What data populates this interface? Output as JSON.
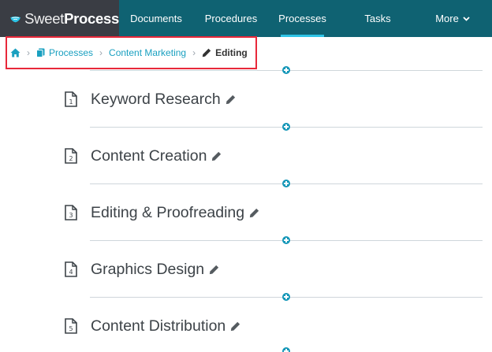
{
  "brand": {
    "light": "Sweet",
    "bold": "Process"
  },
  "nav": {
    "items": [
      {
        "label": "Documents"
      },
      {
        "label": "Procedures"
      },
      {
        "label": "Processes"
      },
      {
        "label": "Tasks"
      },
      {
        "label": "More"
      }
    ],
    "active": "Processes"
  },
  "breadcrumb": {
    "home_icon": "home-icon",
    "processes": "Processes",
    "parent": "Content Marketing",
    "current": "Editing",
    "separator": "›"
  },
  "steps": [
    {
      "number": "1",
      "title": "Keyword Research"
    },
    {
      "number": "2",
      "title": "Content Creation"
    },
    {
      "number": "3",
      "title": "Editing & Proofreading"
    },
    {
      "number": "4",
      "title": "Graphics Design"
    },
    {
      "number": "5",
      "title": "Content Distribution"
    }
  ],
  "colors": {
    "nav_bg": "#0f6272",
    "brand_bg": "#3a3d44",
    "active_underline": "#2ec4e6",
    "link": "#1aa0c0",
    "highlight_box": "#e8283a",
    "add_button": "#1597b8"
  }
}
